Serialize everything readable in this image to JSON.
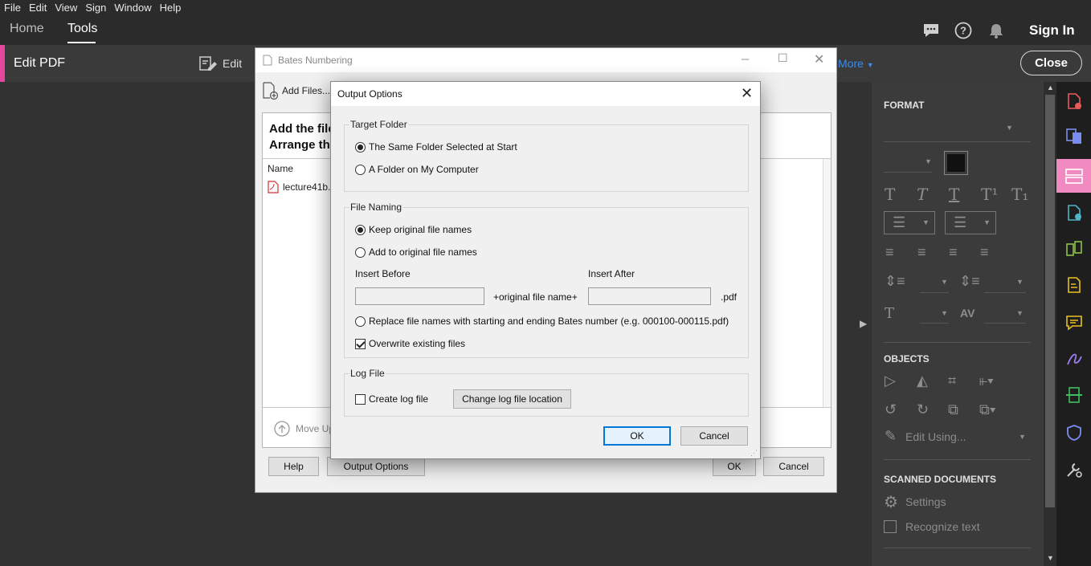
{
  "menubar": {
    "items": [
      "File",
      "Edit",
      "View",
      "Sign",
      "Window",
      "Help"
    ]
  },
  "header": {
    "tabs": [
      "Home",
      "Tools"
    ],
    "active_tab": "Tools",
    "icons": [
      "comment-icon",
      "help-icon",
      "bell-icon"
    ],
    "sign_in_label": "Sign In"
  },
  "toolbar": {
    "title": "Edit PDF",
    "edit_label": "Edit",
    "more_label": "More",
    "close_label": "Close",
    "accent_color": "#e5479f",
    "link_color": "#3b8bf0"
  },
  "bates_window": {
    "title": "Bates Numbering",
    "add_files_label": "Add Files...",
    "instructions": [
      "Add the files",
      "Arrange the"
    ],
    "column_name": "Name",
    "files": [
      "lecture41b.pdf"
    ],
    "move_up_label": "Move Up",
    "help_label": "Help",
    "output_options_label": "Output Options",
    "ok_label": "OK",
    "cancel_label": "Cancel"
  },
  "output_dialog": {
    "title": "Output Options",
    "target_folder": {
      "legend": "Target Folder",
      "options": [
        "The Same Folder Selected at Start",
        "A Folder on My Computer"
      ],
      "selected": 0
    },
    "file_naming": {
      "legend": "File Naming",
      "options": [
        "Keep original file names",
        "Add to original file names"
      ],
      "selected": 0,
      "insert_before_label": "Insert Before",
      "insert_after_label": "Insert After",
      "insert_before_value": "",
      "insert_after_value": "",
      "middle_text": "+original file name+",
      "ext_text": ".pdf",
      "replace_option": "Replace file names with starting and ending Bates number (e.g. 000100-000115.pdf)",
      "overwrite_label": "Overwrite existing files",
      "overwrite_checked": true
    },
    "log_file": {
      "legend": "Log File",
      "create_label": "Create log file",
      "create_checked": false,
      "change_location_label": "Change log file location"
    },
    "ok_label": "OK",
    "cancel_label": "Cancel"
  },
  "right_panel": {
    "format_heading": "FORMAT",
    "objects_heading": "OBJECTS",
    "edit_using_label": "Edit Using...",
    "scanned_heading": "SCANNED DOCUMENTS",
    "settings_label": "Settings",
    "recognize_label": "Recognize text",
    "rail_active_color": "#f08ac0"
  }
}
